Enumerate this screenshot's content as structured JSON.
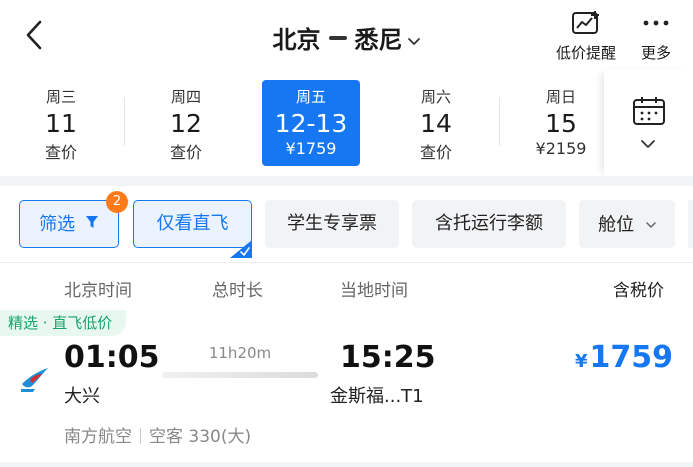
{
  "header": {
    "from": "北京",
    "to": "悉尼",
    "price_alert_label": "低价提醒",
    "more_label": "更多",
    "icons": [
      "back-arrow-icon",
      "chevron-down-icon",
      "price-chart-icon",
      "more-dots-icon"
    ]
  },
  "dates": [
    {
      "weekday": "周三",
      "day": "11",
      "price": "查价",
      "selected": false
    },
    {
      "weekday": "周四",
      "day": "12",
      "price": "查价",
      "selected": false
    },
    {
      "weekday": "周五",
      "day": "12-13",
      "price": "¥1759",
      "selected": true
    },
    {
      "weekday": "周六",
      "day": "14",
      "price": "查价",
      "selected": false
    },
    {
      "weekday": "周日",
      "day": "15",
      "price": "¥2159",
      "selected": false
    }
  ],
  "filters": {
    "filter_label": "筛选",
    "filter_count": "2",
    "direct_only_label": "仅看直飞",
    "student_label": "学生专享票",
    "baggage_label": "含托运行李额",
    "cabin_label": "舱位"
  },
  "columns": {
    "beijing_time": "北京时间",
    "duration": "总时长",
    "local_time": "当地时间",
    "price_incl_tax": "含税价"
  },
  "flight": {
    "tag": "精选 · 直飞低价",
    "departure_time": "01:05",
    "departure_airport": "大兴",
    "duration": "11h20m",
    "arrival_time": "15:25",
    "arrival_airport": "金斯福...T1",
    "currency": "¥",
    "price": "1759",
    "airline": "南方航空",
    "aircraft": "空客 330(大)"
  },
  "colors": {
    "accent": "#1677f2",
    "badge": "#ff7a1a",
    "tag_green": "#17a36a"
  }
}
